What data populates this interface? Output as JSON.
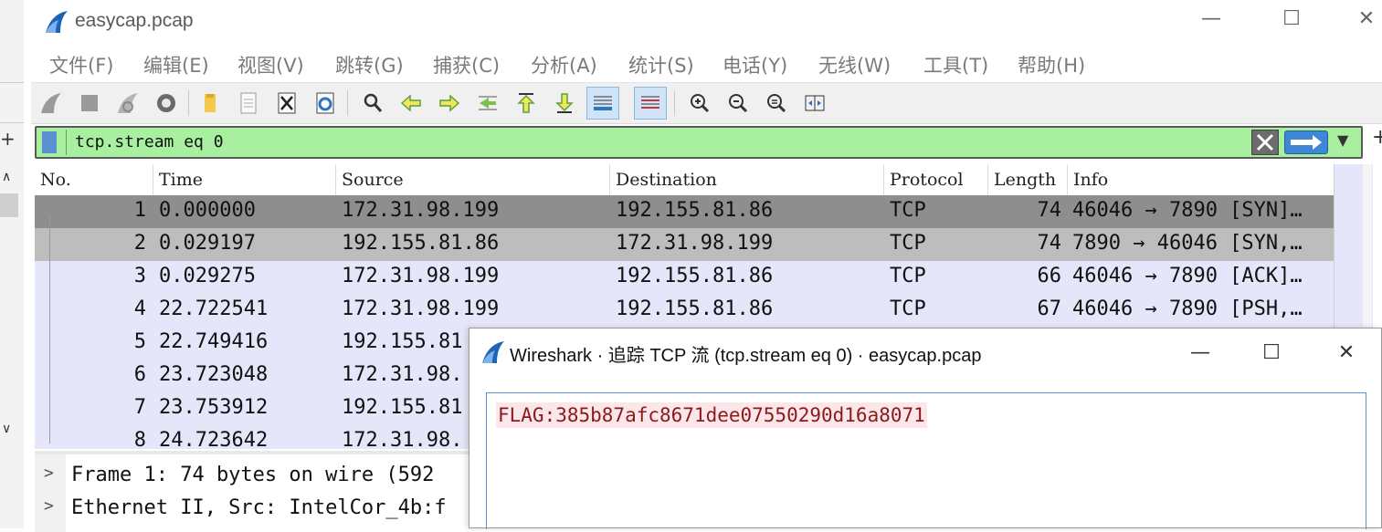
{
  "window": {
    "title": "easycap.pcap",
    "minimize": "—",
    "maximize": "☐",
    "close": "✕"
  },
  "menu": [
    "文件(F)",
    "编辑(E)",
    "视图(V)",
    "跳转(G)",
    "捕获(C)",
    "分析(A)",
    "统计(S)",
    "电话(Y)",
    "无线(W)",
    "工具(T)",
    "帮助(H)"
  ],
  "filter": {
    "value": "tcp.stream eq 0",
    "plus": "+"
  },
  "columns": [
    "No.",
    "Time",
    "Source",
    "Destination",
    "Protocol",
    "Length",
    "Info"
  ],
  "packets": [
    {
      "no": "1",
      "time": "0.000000",
      "src": "172.31.98.199",
      "dst": "192.155.81.86",
      "proto": "TCP",
      "len": "74",
      "info": "46046 → 7890 [SYN]…"
    },
    {
      "no": "2",
      "time": "0.029197",
      "src": "192.155.81.86",
      "dst": "172.31.98.199",
      "proto": "TCP",
      "len": "74",
      "info": "7890 → 46046 [SYN,…"
    },
    {
      "no": "3",
      "time": "0.029275",
      "src": "172.31.98.199",
      "dst": "192.155.81.86",
      "proto": "TCP",
      "len": "66",
      "info": "46046 → 7890 [ACK]…"
    },
    {
      "no": "4",
      "time": "22.722541",
      "src": "172.31.98.199",
      "dst": "192.155.81.86",
      "proto": "TCP",
      "len": "67",
      "info": "46046 → 7890 [PSH,…"
    },
    {
      "no": "5",
      "time": "22.749416",
      "src": "192.155.81",
      "dst": "",
      "proto": "",
      "len": "",
      "info": ""
    },
    {
      "no": "6",
      "time": "23.723048",
      "src": "172.31.98.",
      "dst": "",
      "proto": "",
      "len": "",
      "info": ""
    },
    {
      "no": "7",
      "time": "23.753912",
      "src": "192.155.81",
      "dst": "",
      "proto": "",
      "len": "",
      "info": ""
    },
    {
      "no": "8",
      "time": "24.723642",
      "src": "172.31.98.",
      "dst": "",
      "proto": "",
      "len": "",
      "info": ""
    }
  ],
  "details": [
    {
      "text": "Frame 1: 74 bytes on wire (592"
    },
    {
      "text": "Ethernet II, Src: IntelCor_4b:f"
    }
  ],
  "dialog": {
    "title": "Wireshark · 追踪 TCP 流 (tcp.stream eq 0) · easycap.pcap",
    "content": "FLAG:385b87afc8671dee07550290d16a8071",
    "minimize": "—",
    "maximize": "☐",
    "close": "✕"
  },
  "colors": {
    "filter_bg": "#a8f0a0",
    "row_selected": "#8e8e8e",
    "row_related": "#bdbdbd",
    "row_default": "#e6e6fa",
    "flag_fg": "#8b1a1a",
    "flag_bg": "#fbe7ea"
  },
  "icons": [
    "wireshark-fin-icon",
    "start-capture-icon",
    "stop-capture-icon",
    "restart-capture-icon",
    "capture-options-icon",
    "open-file-icon",
    "save-file-icon",
    "close-file-icon",
    "reload-file-icon",
    "find-packet-icon",
    "go-back-icon",
    "go-forward-icon",
    "go-to-packet-icon",
    "go-first-icon",
    "go-last-icon",
    "autoscroll-icon",
    "colorize-icon",
    "zoom-in-icon",
    "zoom-out-icon",
    "zoom-normal-icon",
    "resize-columns-icon"
  ]
}
